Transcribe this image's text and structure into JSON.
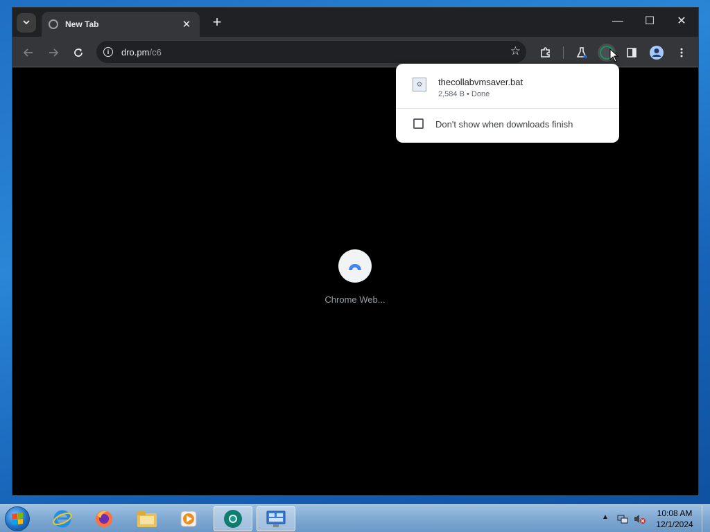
{
  "browser": {
    "tab": {
      "title": "New Tab"
    },
    "address": {
      "host": "dro.pm",
      "path": "/c6"
    },
    "loading": {
      "label": "Chrome Web..."
    },
    "colors": {
      "frame": "#202124",
      "toolbar": "#35363a",
      "accent": "#1a73e8"
    }
  },
  "download": {
    "file_name": "thecollabvmsaver.bat",
    "status": "2,584 B • Done",
    "checkbox_label": "Don't show when downloads finish",
    "checked": false
  },
  "taskbar": {
    "pinned": [
      "internet-explorer",
      "firefox",
      "file-explorer",
      "media-player",
      "chrome-beta",
      "control-panel"
    ],
    "clock": {
      "time": "10:08 AM",
      "date": "12/1/2024"
    }
  },
  "icons": {
    "tab_search": "chevron-down-icon",
    "tab_close": "close-icon",
    "new_tab": "plus-icon",
    "back": "back-arrow-icon",
    "forward": "forward-arrow-icon",
    "reload": "reload-icon",
    "site_info": "info-icon",
    "bookmark": "star-icon",
    "extensions": "puzzle-icon",
    "labs": "flask-icon",
    "downloads": "download-icon",
    "side_panel": "side-panel-icon",
    "profile": "profile-icon",
    "menu": "kebab-menu-icon"
  }
}
